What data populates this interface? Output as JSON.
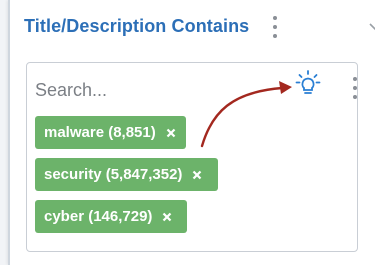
{
  "header": {
    "title": "Title/Description Contains"
  },
  "search": {
    "placeholder": "Search..."
  },
  "chips": [
    {
      "label": "malware (8,851)"
    },
    {
      "label": "security (5,847,352)"
    },
    {
      "label": "cyber (146,729)"
    }
  ],
  "icons": {
    "header_menu": "vertical-ellipsis",
    "collapse": "chevron-down",
    "suggest": "lightbulb",
    "box_menu": "vertical-ellipsis",
    "remove": "close-x",
    "annotation": "curved-arrow"
  },
  "colors": {
    "title": "#2c6fb7",
    "chip": "#6cb36a",
    "bulb": "#2a7fd4",
    "arrow": "#a3281f"
  }
}
